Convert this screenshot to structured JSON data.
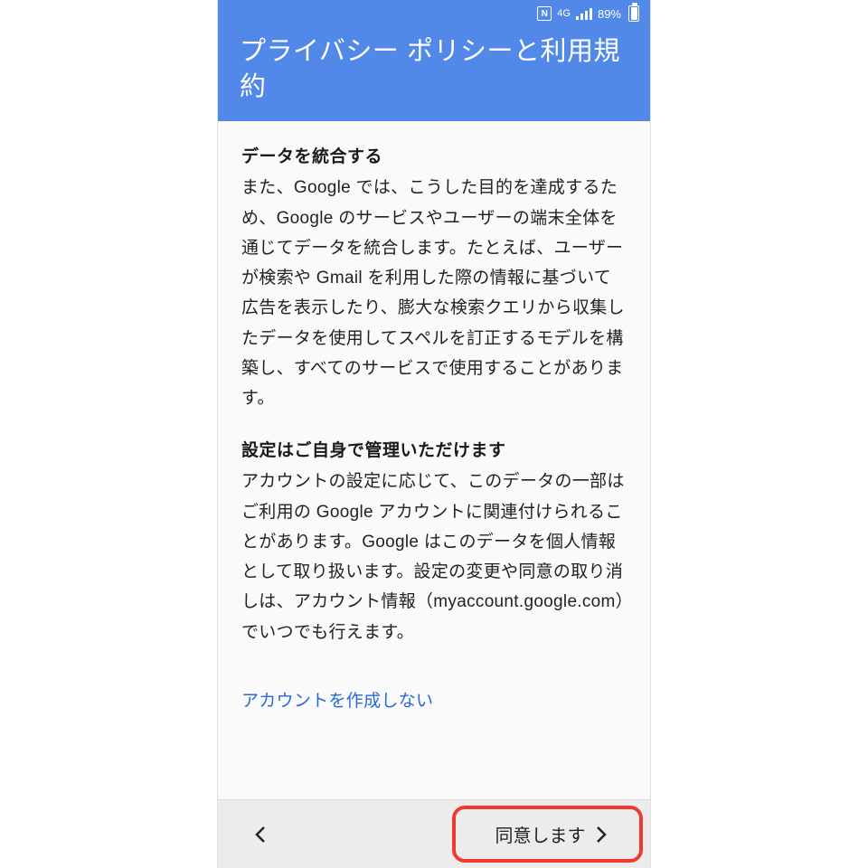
{
  "status": {
    "nfc": "N",
    "network": "4G",
    "battery_text": "89%"
  },
  "header": {
    "title": "プライバシー ポリシーと利用規約"
  },
  "sections": [
    {
      "heading": "データを統合する",
      "body": "また、Google では、こうした目的を達成するため、Google のサービスやユーザーの端末全体を通じてデータを統合します。たとえば、ユーザーが検索や Gmail を利用した際の情報に基づいて広告を表示したり、膨大な検索クエリから収集したデータを使用してスペルを訂正するモデルを構築し、すべてのサービスで使用することがあります。"
    },
    {
      "heading": "設定はご自身で管理いただけます",
      "body": "アカウントの設定に応じて、このデータの一部はご利用の Google アカウントに関連付けられることがあります。Google はこのデータを個人情報として取り扱います。設定の変更や同意の取り消しは、アカウント情報（myaccount.google.com）でいつでも行えます。"
    }
  ],
  "link": {
    "text": "アカウントを作成しない"
  },
  "footer": {
    "agree_label": "同意します"
  },
  "colors": {
    "header_bg": "#5289e9",
    "link": "#2a6ad6",
    "highlight": "#ef3b2f"
  }
}
